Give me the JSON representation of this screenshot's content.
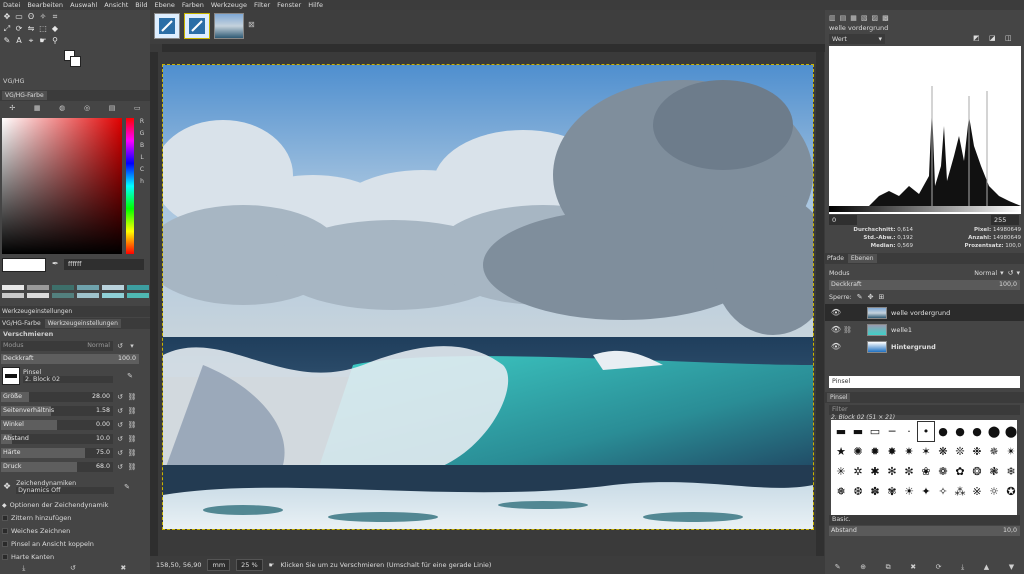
{
  "menu": [
    "Datei",
    "Bearbeiten",
    "Auswahl",
    "Ansicht",
    "Bild",
    "Ebene",
    "Farben",
    "Werkzeuge",
    "Filter",
    "Fenster",
    "Hilfe"
  ],
  "toolbox": {
    "tools": [
      "move-tool",
      "rect-select-tool",
      "lasso-tool",
      "fuzzy-select-tool",
      "crop-tool",
      "transform-tool",
      "warp-tool",
      "flip-tool",
      "perspective-tool",
      "bucket-fill-tool",
      "paths-tool",
      "text-tool",
      "measure-tool",
      "smudge-tool",
      "zoom-tool"
    ]
  },
  "fgbg_title": "VG/HG",
  "color_panel": {
    "title": "VG/HG-Farbe",
    "channels": [
      "R",
      "G",
      "B",
      "L",
      "C",
      "h"
    ],
    "hex_value": "ffffff",
    "swatch_colors": [
      "#e8e8e8",
      "#9a9a9a",
      "#3d6f6a",
      "#6fa3ad",
      "#b9d2dc",
      "#3c9ea0",
      "#c9c9c9",
      "#dadada",
      "#53807e",
      "#9fc3cc",
      "#8fd0d6",
      "#4fb8b2"
    ],
    "field_hue": "#e00000"
  },
  "tool_options": {
    "panel_title": "Werkzeugeinstellungen",
    "tabs": [
      "VG/HG-Farbe",
      "Werkzeugeinstellungen"
    ],
    "tool_name": "Verschmieren",
    "mode_label": "Modus",
    "mode_value": "Normal",
    "opacity_label": "Deckkraft",
    "opacity_value": "100.0",
    "brush_label": "Pinsel",
    "brush_value": "2. Block 02",
    "sliders": [
      {
        "label": "Größe",
        "value": "28.00",
        "fill": 0.25
      },
      {
        "label": "Seitenverhältnis",
        "value": "1.58",
        "fill": 0.45
      },
      {
        "label": "Winkel",
        "value": "0.00",
        "fill": 0.5
      },
      {
        "label": "Abstand",
        "value": "10.0",
        "fill": 0.1
      },
      {
        "label": "Härte",
        "value": "75.0",
        "fill": 0.75
      },
      {
        "label": "Druck",
        "value": "68.0",
        "fill": 0.68
      }
    ],
    "dynamics_label": "Zeichendynamiken",
    "dynamics_value": "Dynamics Off",
    "checks": [
      "Optionen der Zeichendynamik",
      "Zittern hinzufügen",
      "Weiches Zeichnen",
      "Pinsel an Ansicht koppeln",
      "Harte Kanten"
    ]
  },
  "statusbar": {
    "coords": "158,50, 56,90",
    "unit": "mm",
    "zoom": "25 %",
    "message": "Klicken Sie um zu Verschmieren (Umschalt für eine gerade Linie)"
  },
  "histogram": {
    "title": "welle vordergrund",
    "channel": "Wert",
    "range_start": "0",
    "range_end": "255",
    "stats_left": [
      {
        "label": "Durchschnitt:",
        "value": "0,614"
      },
      {
        "label": "Std.-Abw.:",
        "value": "0,192"
      },
      {
        "label": "Median:",
        "value": "0,569"
      }
    ],
    "stats_right": [
      {
        "label": "Pixel:",
        "value": "14980649"
      },
      {
        "label": "Anzahl:",
        "value": "14980649"
      },
      {
        "label": "Prozentsatz:",
        "value": "100,0"
      }
    ]
  },
  "layers": {
    "tabs": [
      "Pfade",
      "Ebenen"
    ],
    "mode_label": "Modus",
    "mode_value": "Normal",
    "opacity_label": "Deckkraft",
    "opacity_value": "100,0",
    "lock_label": "Sperre:",
    "items": [
      {
        "name": "welle vordergrund",
        "selected": true
      },
      {
        "name": "welle1",
        "selected": false
      },
      {
        "name": "Hintergrund",
        "selected": false
      }
    ]
  },
  "brushes": {
    "search_label": "Pinsel",
    "panel_title": "Pinsel",
    "filter_placeholder": "Filter",
    "selected_brush": "2. Block 02 (51 × 21)",
    "tag_value": "Basic.",
    "spacing_label": "Abstand",
    "spacing_value": "10,0"
  }
}
